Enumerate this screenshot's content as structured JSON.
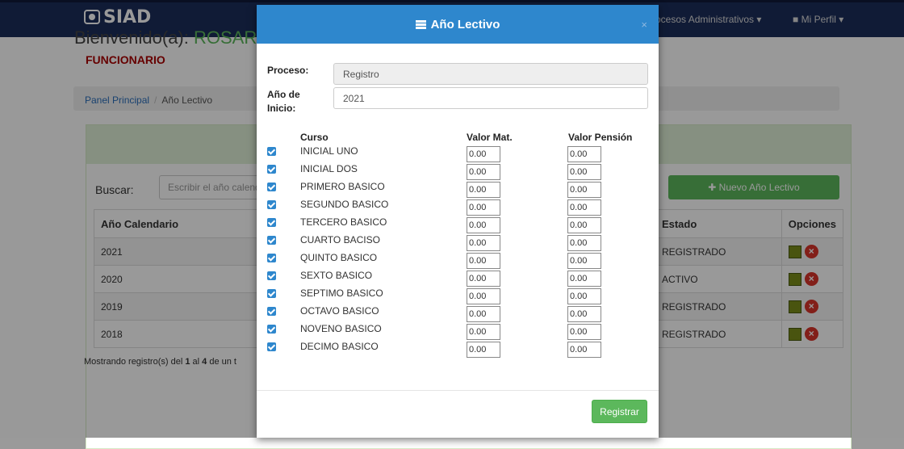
{
  "nav": {
    "brand": "SIAD",
    "menu_procesos": "Procesos Administrativos ▾",
    "menu_perfil": "Mi Perfil ▾"
  },
  "welcome": {
    "prefix": "Bienvenido(a): ",
    "name": "ROSARIO"
  },
  "role": "FUNCIONARIO",
  "breadcrumb": {
    "home": "Panel Principal",
    "current": "Año Lectivo"
  },
  "search": {
    "label": "Buscar:",
    "placeholder": "Escribir el año calendario"
  },
  "new_button": "✚ Nuevo Año Lectivo",
  "table": {
    "headers": [
      "Año Calendario",
      "Estado",
      "Opciones"
    ],
    "rows": [
      {
        "year": "2021",
        "status": "REGISTRADO"
      },
      {
        "year": "2020",
        "status": "ACTIVO"
      },
      {
        "year": "2019",
        "status": "REGISTRADO"
      },
      {
        "year": "2018",
        "status": "REGISTRADO"
      }
    ]
  },
  "footer_text": {
    "prefix": "Mostrando registro(s) del ",
    "from": "1",
    "mid": " al ",
    "to": "4",
    "suffix": " de un t"
  },
  "modal": {
    "title": "Año Lectivo",
    "close": "×",
    "proceso_label": "Proceso:",
    "proceso_value": "Registro",
    "inicio_label": "Año de Inicio:",
    "inicio_value": "2021",
    "col_curso": "Curso",
    "col_mat": "Valor Mat.",
    "col_pension": "Valor Pensión",
    "courses": [
      {
        "name": "INICIAL UNO",
        "mat": "0.00",
        "pension": "0.00",
        "checked": true
      },
      {
        "name": "INICIAL DOS",
        "mat": "0.00",
        "pension": "0.00",
        "checked": true
      },
      {
        "name": "PRIMERO BASICO",
        "mat": "0.00",
        "pension": "0.00",
        "checked": true
      },
      {
        "name": "SEGUNDO BASICO",
        "mat": "0.00",
        "pension": "0.00",
        "checked": true
      },
      {
        "name": "TERCERO BASICO",
        "mat": "0.00",
        "pension": "0.00",
        "checked": true
      },
      {
        "name": "CUARTO BACISO",
        "mat": "0.00",
        "pension": "0.00",
        "checked": true
      },
      {
        "name": "QUINTO BASICO",
        "mat": "0.00",
        "pension": "0.00",
        "checked": true
      },
      {
        "name": "SEXTO BASICO",
        "mat": "0.00",
        "pension": "0.00",
        "checked": true
      },
      {
        "name": "SEPTIMO BASICO",
        "mat": "0.00",
        "pension": "0.00",
        "checked": true
      },
      {
        "name": "OCTAVO BASICO",
        "mat": "0.00",
        "pension": "0.00",
        "checked": true
      },
      {
        "name": "NOVENO BASICO",
        "mat": "0.00",
        "pension": "0.00",
        "checked": true
      },
      {
        "name": "DECIMO BASICO",
        "mat": "0.00",
        "pension": "0.00",
        "checked": true
      }
    ],
    "submit": "Registrar"
  },
  "colors": {
    "navbar": "#1c2d5a",
    "modal_header": "#2e87cd",
    "success": "#5cb85c",
    "role": "#aa0000"
  },
  "icons": {
    "brand": "camera-icon",
    "title": "list-icon",
    "edit": "edit-icon",
    "delete": "delete-icon",
    "user": "user-icon",
    "plus": "plus-icon"
  }
}
